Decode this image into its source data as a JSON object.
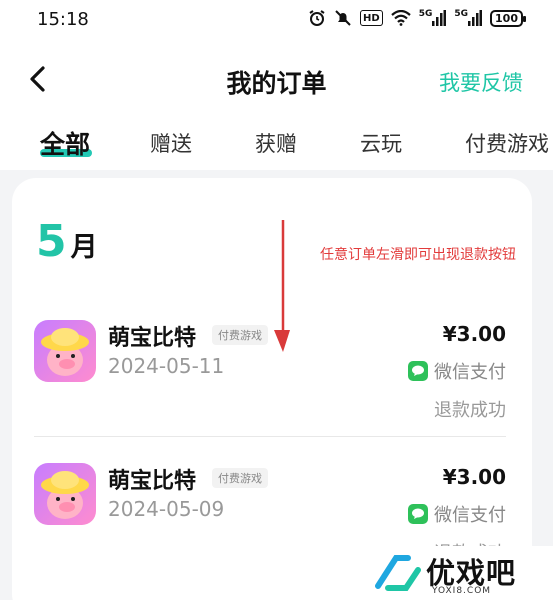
{
  "status_bar": {
    "time": "15:18",
    "hd": "HD",
    "signal1": "5G",
    "signal2": "5G",
    "battery": "100"
  },
  "nav": {
    "title": "我的订单",
    "feedback": "我要反馈",
    "back_icon": "chevron-left-icon"
  },
  "tabs": [
    {
      "label": "全部",
      "active": true
    },
    {
      "label": "赠送"
    },
    {
      "label": "获赠"
    },
    {
      "label": "云玩"
    },
    {
      "label": "付费游戏"
    }
  ],
  "section": {
    "month_number": "5",
    "month_unit": "月",
    "hint": "任意订单左滑即可出现退款按钮"
  },
  "orders": [
    {
      "name": "萌宝比特",
      "tag": "付费游戏",
      "date": "2024-05-11",
      "price": "¥3.00",
      "payment": "微信支付",
      "status": "退款成功"
    },
    {
      "name": "萌宝比特",
      "tag": "付费游戏",
      "date": "2024-05-09",
      "price": "¥3.00",
      "payment": "微信支付",
      "status": "退款成功"
    }
  ],
  "watermark": {
    "text": "优戏吧",
    "url": "YOXI8.COM"
  },
  "colors": {
    "accent": "#22c4a7",
    "hint": "#e23b3b",
    "wechat": "#2ec15a"
  }
}
